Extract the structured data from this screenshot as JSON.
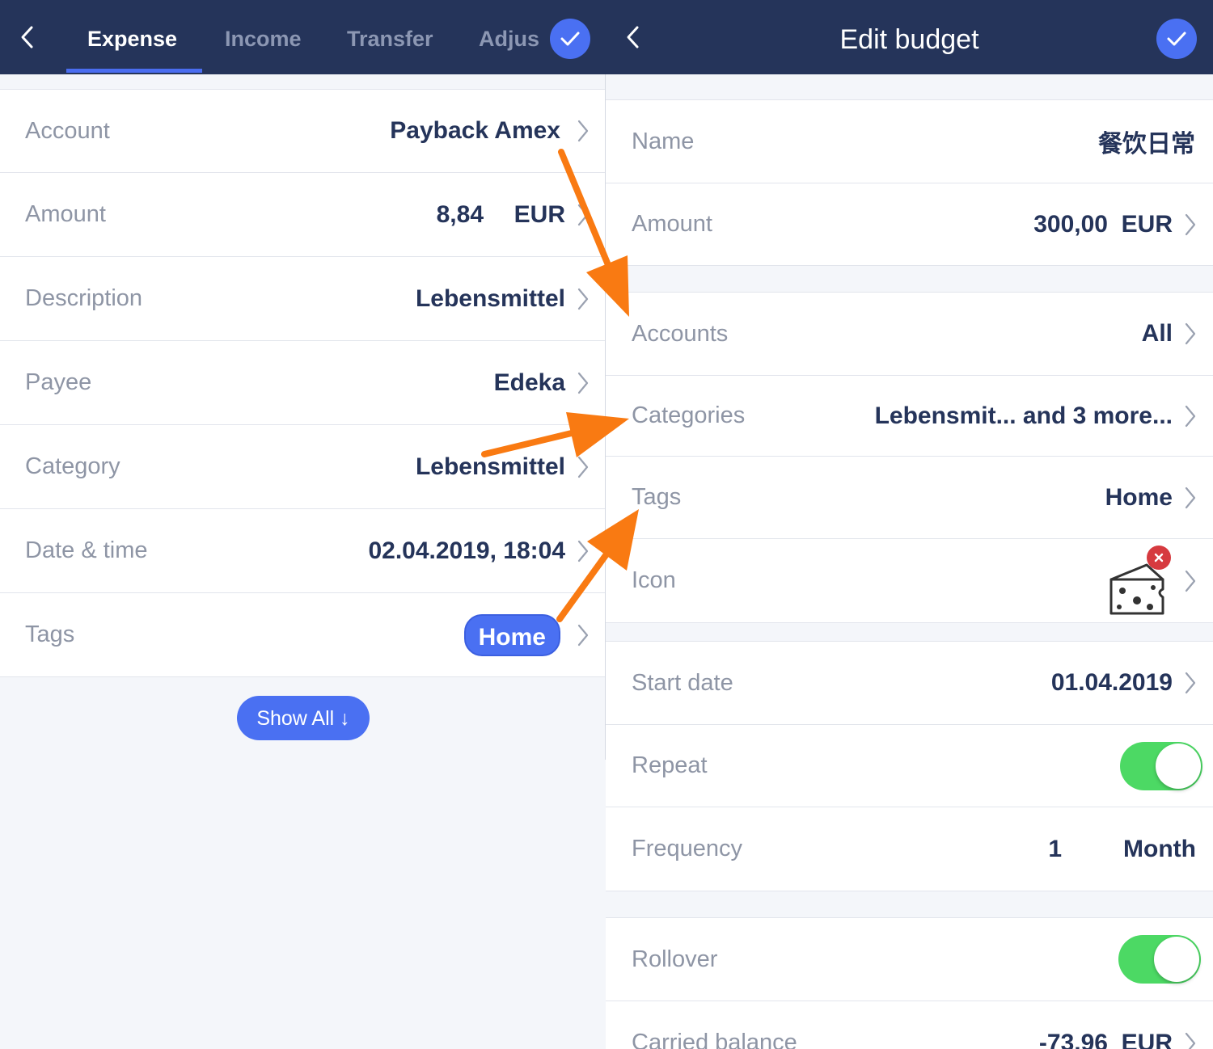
{
  "left": {
    "tabs": [
      {
        "label": "Expense",
        "active": true
      },
      {
        "label": "Income",
        "active": false
      },
      {
        "label": "Transfer",
        "active": false
      },
      {
        "label": "Adjus",
        "active": false
      }
    ],
    "back_icon": "chevron-left-icon",
    "confirm_icon": "checkmark-icon",
    "rows": {
      "account": {
        "label": "Account",
        "value": "Payback Amex"
      },
      "amount": {
        "label": "Amount",
        "value": "8,84",
        "currency": "EUR"
      },
      "description": {
        "label": "Description",
        "value": "Lebensmittel"
      },
      "payee": {
        "label": "Payee",
        "value": "Edeka"
      },
      "category": {
        "label": "Category",
        "value": "Lebensmittel"
      },
      "datetime": {
        "label": "Date & time",
        "value": "02.04.2019, 18:04"
      },
      "tags": {
        "label": "Tags",
        "value": "Home"
      }
    },
    "show_all": "Show All ↓"
  },
  "right": {
    "title": "Edit budget",
    "back_icon": "chevron-left-icon",
    "confirm_icon": "checkmark-icon",
    "rows": {
      "name": {
        "label": "Name",
        "value": "餐饮日常"
      },
      "amount": {
        "label": "Amount",
        "value": "300,00",
        "currency": "EUR"
      },
      "accounts": {
        "label": "Accounts",
        "value": "All"
      },
      "categories": {
        "label": "Categories",
        "value": "Lebensmit... and 3 more..."
      },
      "tags": {
        "label": "Tags",
        "value": "Home"
      },
      "icon": {
        "label": "Icon",
        "icon_name": "cheese-icon"
      },
      "start_date": {
        "label": "Start date",
        "value": "01.04.2019"
      },
      "repeat": {
        "label": "Repeat",
        "on": true
      },
      "frequency": {
        "label": "Frequency",
        "count": "1",
        "unit": "Month"
      },
      "rollover": {
        "label": "Rollover",
        "on": true
      },
      "carried": {
        "label": "Carried balance",
        "value": "-73,96",
        "currency": "EUR"
      }
    }
  },
  "colors": {
    "topbar": "#25345a",
    "accent": "#4a70f2",
    "toggle_on": "#4cd964",
    "annotation_arrow": "#f97a12",
    "value_text": "#25345a",
    "label_text": "#8e95a5"
  }
}
